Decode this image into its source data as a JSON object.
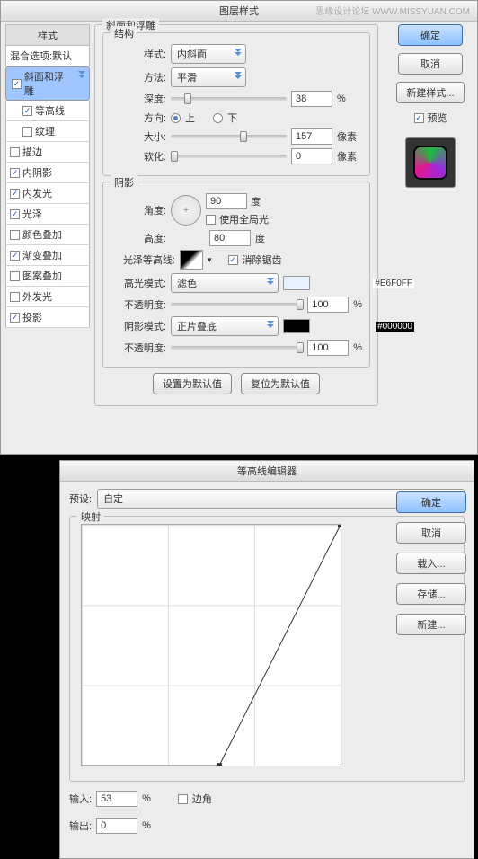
{
  "dlg1": {
    "title": "图层样式",
    "watermark": "思缘设计论坛  WWW.MISSYUAN.COM",
    "styles_header": "样式",
    "blend_options": "混合选项:默认",
    "styles": [
      {
        "label": "斜面和浮雕",
        "on": true,
        "sel": true
      },
      {
        "label": "等高线",
        "on": true,
        "sub": true
      },
      {
        "label": "纹理",
        "on": false,
        "sub": true
      },
      {
        "label": "描边",
        "on": false
      },
      {
        "label": "内阴影",
        "on": true
      },
      {
        "label": "内发光",
        "on": true
      },
      {
        "label": "光泽",
        "on": true
      },
      {
        "label": "颜色叠加",
        "on": false
      },
      {
        "label": "渐变叠加",
        "on": true
      },
      {
        "label": "图案叠加",
        "on": false
      },
      {
        "label": "外发光",
        "on": false
      },
      {
        "label": "投影",
        "on": true
      }
    ],
    "bevel": {
      "legend": "斜面和浮雕",
      "structure": "结构",
      "style_lbl": "样式:",
      "style_val": "内斜面",
      "method_lbl": "方法:",
      "method_val": "平滑",
      "depth_lbl": "深度:",
      "depth_val": "38",
      "pct": "%",
      "dir_lbl": "方向:",
      "up": "上",
      "down": "下",
      "size_lbl": "大小:",
      "size_val": "157",
      "px": "像素",
      "soften_lbl": "软化:",
      "soften_val": "0"
    },
    "shading": {
      "legend": "阴影",
      "angle_lbl": "角度:",
      "angle_val": "90",
      "deg": "度",
      "global": "使用全局光",
      "alt_lbl": "高度:",
      "alt_val": "80",
      "gloss_lbl": "光泽等高线:",
      "antialias": "消除锯齿",
      "hmode_lbl": "高光模式:",
      "hmode_val": "滤色",
      "hcolor": "#E6F0FF",
      "hcolor_txt": "#E6F0FF",
      "hopacity_lbl": "不透明度:",
      "hopacity_val": "100",
      "smode_lbl": "阴影模式:",
      "smode_val": "正片叠底",
      "scolor": "#000000",
      "scolor_txt": "#000000",
      "sopacity_lbl": "不透明度:",
      "sopacity_val": "100"
    },
    "defaults": {
      "set": "设置为默认值",
      "reset": "复位为默认值"
    },
    "buttons": {
      "ok": "确定",
      "cancel": "取消",
      "new": "新建样式...",
      "preview": "预览"
    }
  },
  "dlg2": {
    "title": "等高线编辑器",
    "preset_lbl": "预设:",
    "preset_val": "自定",
    "mapping": "映射",
    "input_lbl": "输入:",
    "input_val": "53",
    "pct": "%",
    "output_lbl": "输出:",
    "output_val": "0",
    "corner": "边角",
    "buttons": {
      "ok": "确定",
      "cancel": "取消",
      "load": "载入...",
      "save": "存储...",
      "new": "新建..."
    }
  },
  "chart_data": {
    "type": "line",
    "title": "映射",
    "xlabel": "输入",
    "ylabel": "输出",
    "xlim": [
      0,
      100
    ],
    "ylim": [
      0,
      100
    ],
    "points": [
      {
        "x": 0,
        "y": 0
      },
      {
        "x": 53,
        "y": 0
      },
      {
        "x": 100,
        "y": 100
      }
    ]
  }
}
